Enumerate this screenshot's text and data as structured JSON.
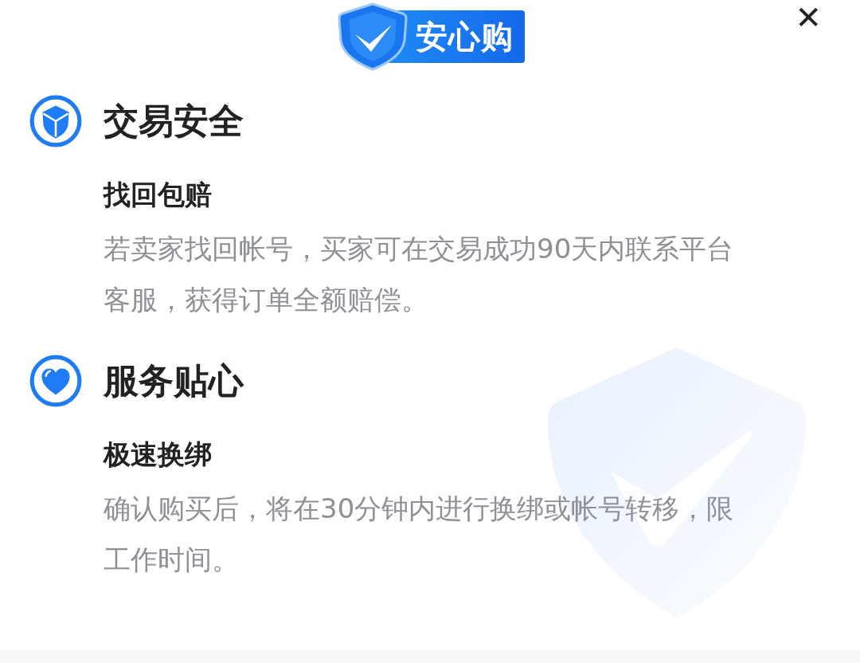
{
  "logo": {
    "text": "安心购"
  },
  "close": {
    "text": "✕"
  },
  "sections": [
    {
      "kind": "cube",
      "title": "交易安全",
      "subtitle": "找回包赔",
      "body": "若卖家找回帐号，买家可在交易成功90天内联系平台客服，获得订单全额赔偿。"
    },
    {
      "kind": "heart",
      "title": "服务贴心",
      "subtitle": "极速换绑",
      "body": "确认购买后，将在30分钟内进行换绑或帐号转移，限工作时间。"
    }
  ]
}
